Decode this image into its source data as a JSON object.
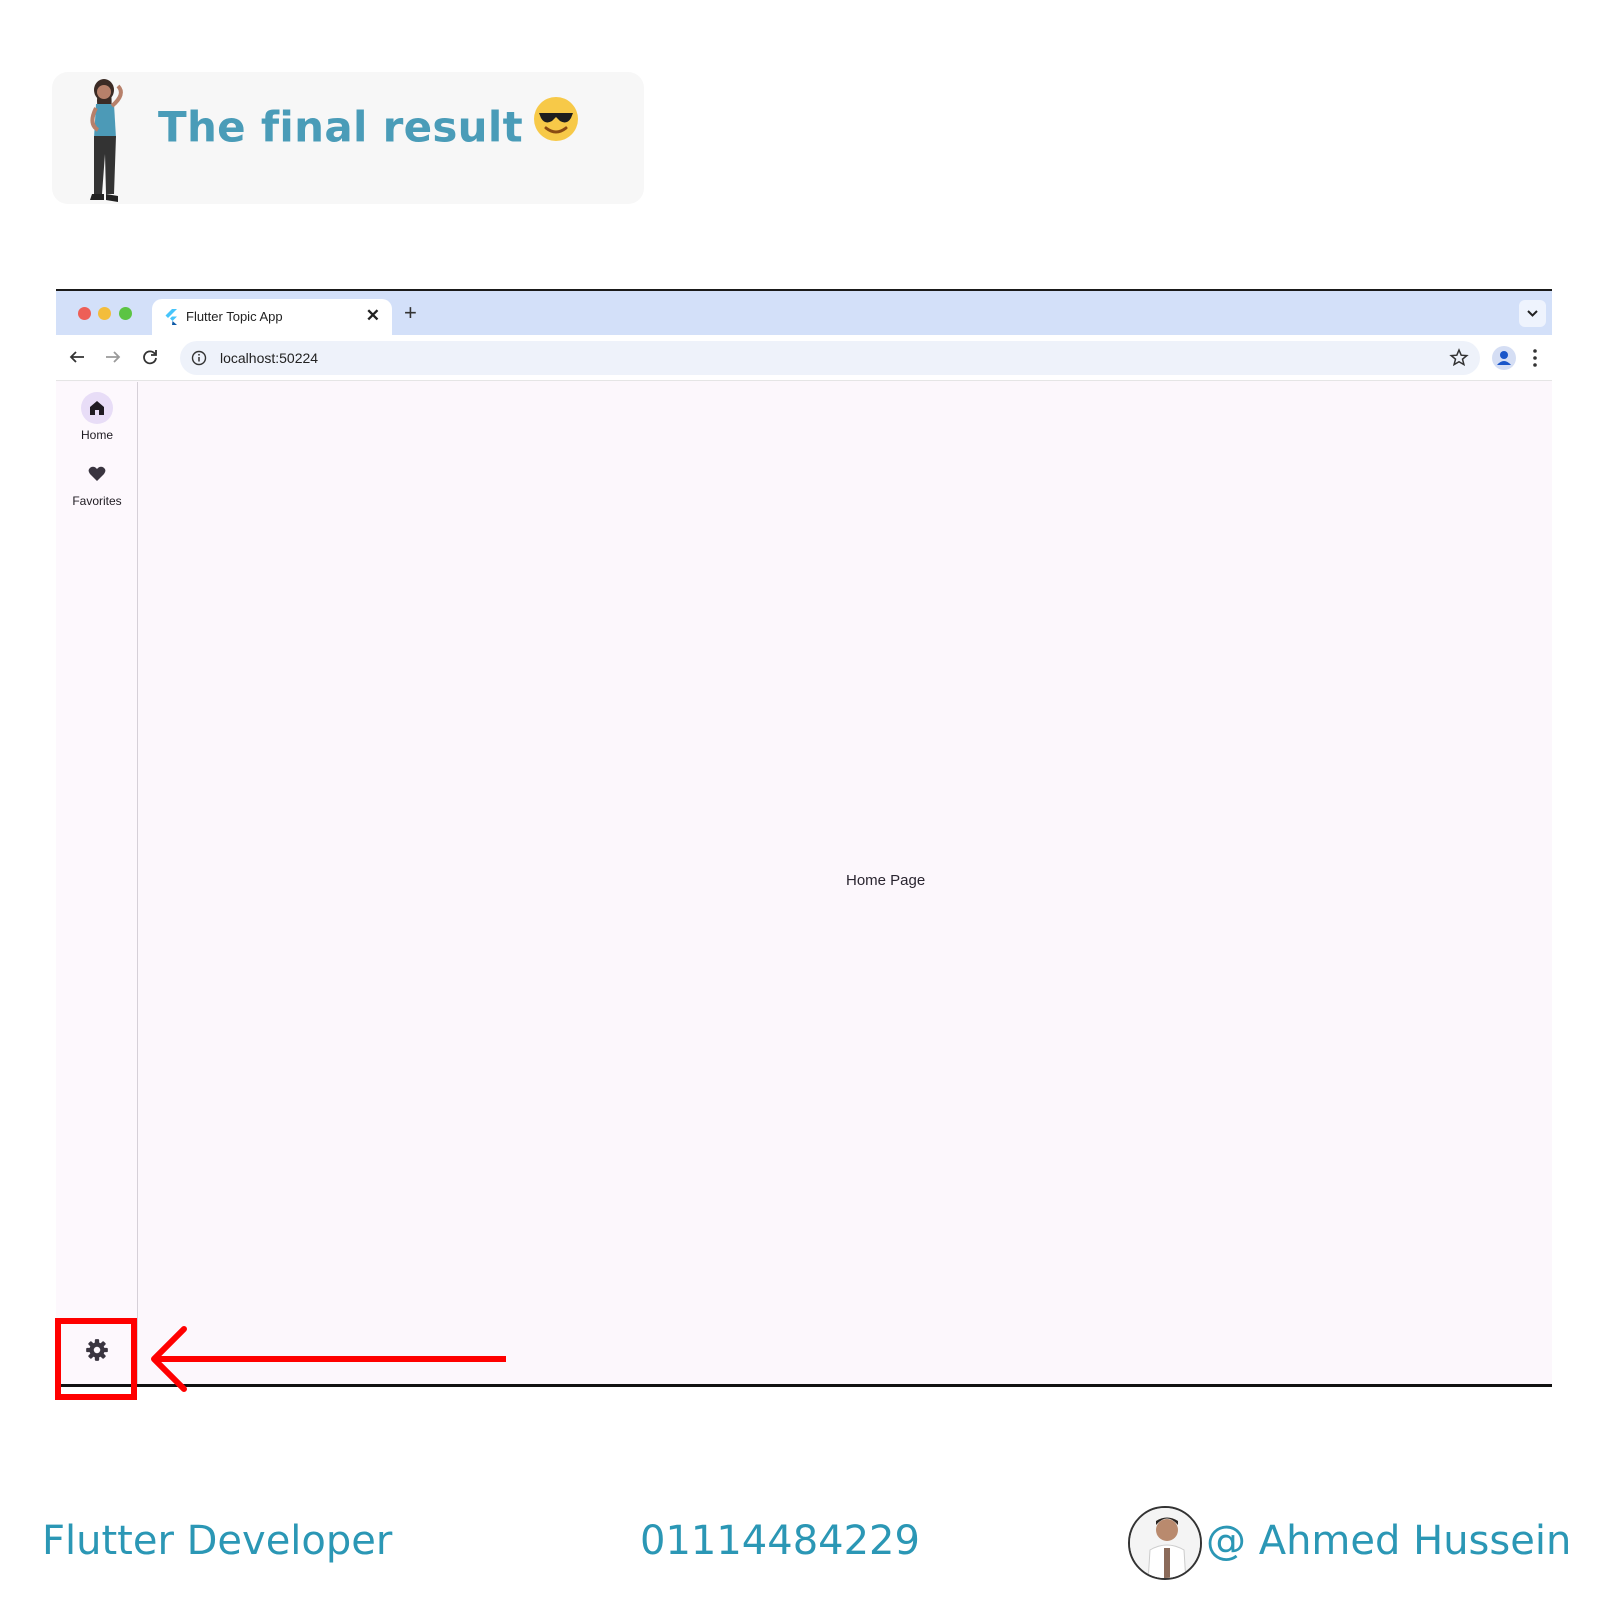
{
  "header": {
    "title": "The final result",
    "emoji_icon": "smiling-face-with-sunglasses-icon",
    "illustration": "thinking-person-illustration"
  },
  "browser": {
    "tab_title": "Flutter Topic App",
    "tab_favicon": "flutter-logo-icon",
    "url": "localhost:50224"
  },
  "app": {
    "nav": [
      {
        "label": "Home",
        "icon": "home-icon",
        "selected": true
      },
      {
        "label": "Favorites",
        "icon": "heart-icon",
        "selected": false
      }
    ],
    "body_text": "Home Page",
    "settings_icon": "gear-icon"
  },
  "annotation": {
    "color": "#ff0000"
  },
  "footer": {
    "role": "Flutter Developer",
    "phone": "01114484229",
    "name": "@ Ahmed Hussein"
  },
  "colors": {
    "accent_teal": "#2b97b5",
    "rail_indicator": "#e8ddf7",
    "tab_strip": "#d3e0f9"
  }
}
